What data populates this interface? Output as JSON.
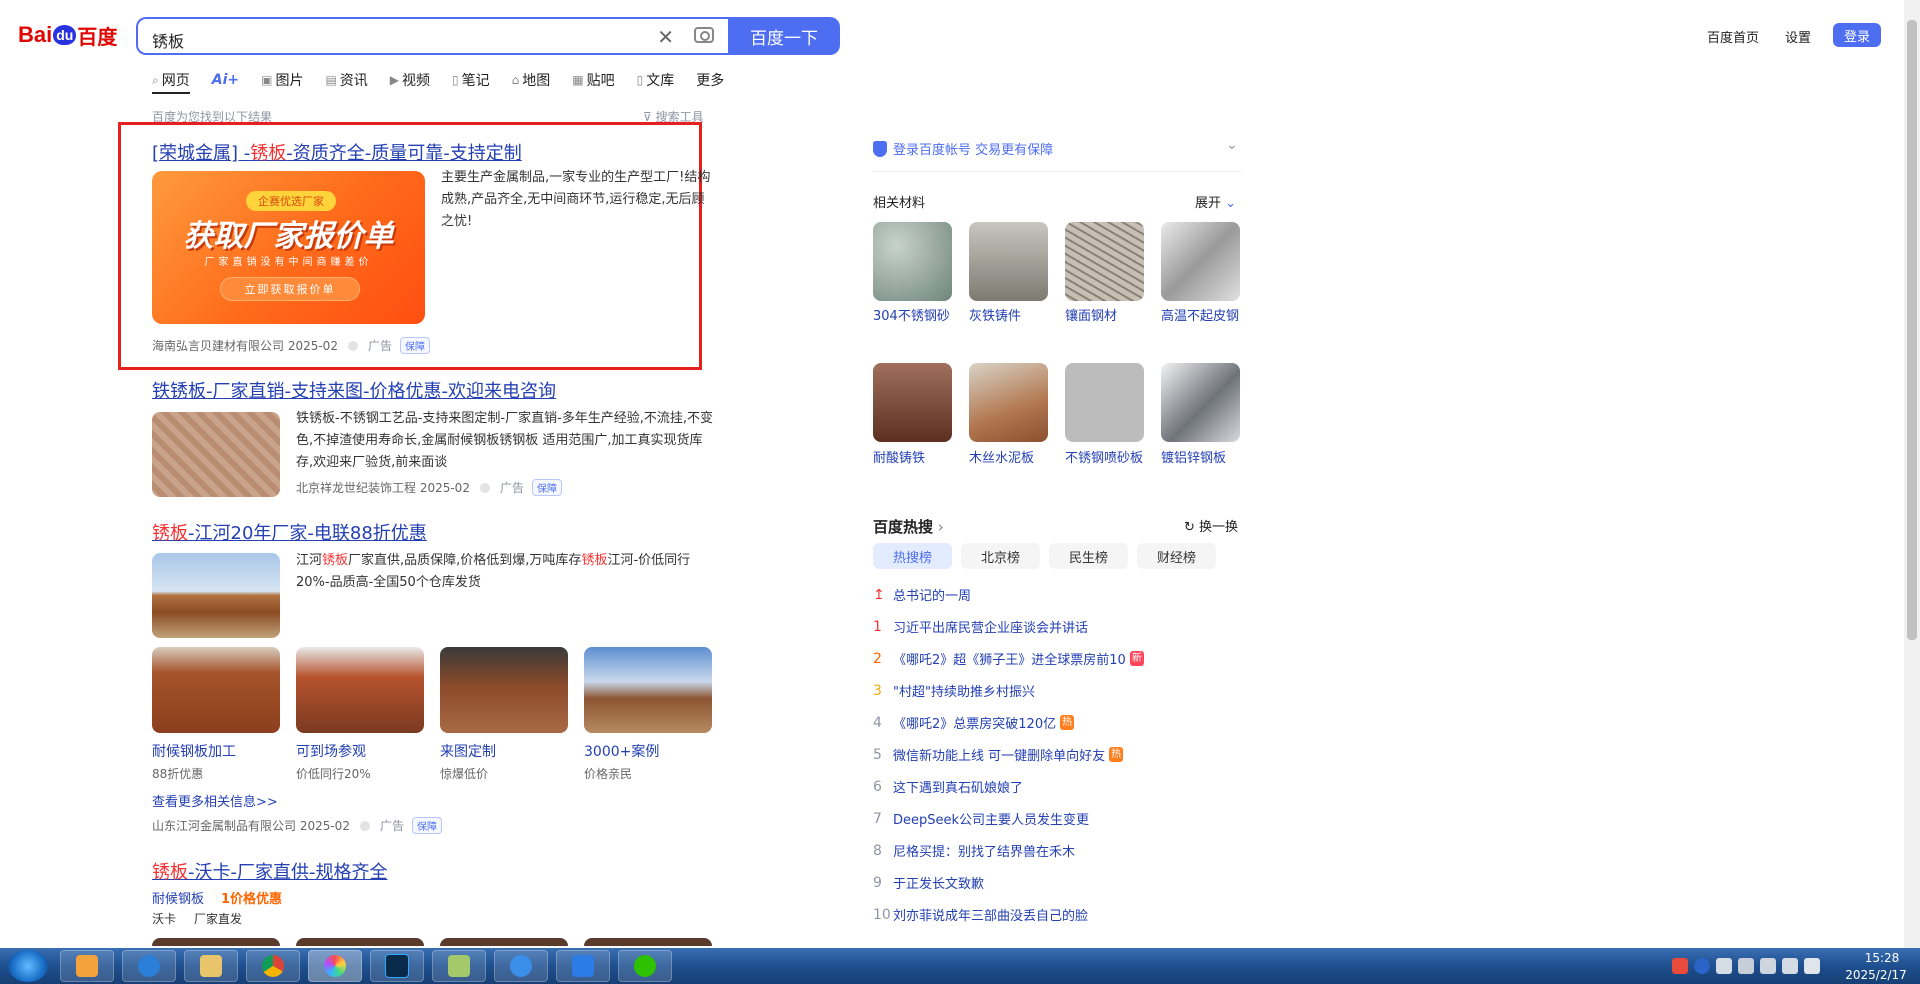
{
  "header": {
    "logo_bai": "Bai",
    "logo_du": "du",
    "logo_cn": "百度",
    "query": "锈板",
    "search_button": "百度一下",
    "links": [
      "百度首页",
      "设置"
    ],
    "login": "登录"
  },
  "tabs": [
    {
      "label": "网页",
      "icon": "search-icon"
    },
    {
      "label": "Ai+",
      "icon": ""
    },
    {
      "label": "图片",
      "icon": "image-icon"
    },
    {
      "label": "资讯",
      "icon": "news-icon"
    },
    {
      "label": "视频",
      "icon": "video-icon"
    },
    {
      "label": "笔记",
      "icon": "note-icon"
    },
    {
      "label": "地图",
      "icon": "map-icon"
    },
    {
      "label": "贴吧",
      "icon": "tieba-icon"
    },
    {
      "label": "文库",
      "icon": "doc-icon"
    },
    {
      "label": "更多",
      "icon": ""
    }
  ],
  "result_tip": "百度为您找到以下结果",
  "search_tools": "搜索工具",
  "results": {
    "r1": {
      "title_pre": "[荣城金属] -",
      "title_em": "锈板",
      "title_post": "-资质齐全-质量可靠-支持定制",
      "desc": "主要生产金属制品,一家专业的生产型工厂!结构成熟,产品齐全,无中间商环节,运行稳定,无后顾之忧!",
      "source": "海南弘言贝建材有限公司 2025-02",
      "ad": "广告",
      "guarantee": "保障",
      "banner": {
        "tag": "企赛优选厂家",
        "headline": "获取厂家报价单",
        "subline": "厂家直销没有中间商赚差价",
        "cta": "立即获取报价单"
      }
    },
    "r2": {
      "title": "铁锈板-厂家直销-支持来图-价格优惠-欢迎来电咨询",
      "desc": "铁锈板-不锈钢工艺品-支持来图定制-厂家直销-多年生产经验,不流挂,不变色,不掉渣使用寿命长,金属耐候钢板锈钢板 适用范围广,加工真实现货库存,欢迎来厂验货,前来面谈",
      "source": "北京祥龙世纪装饰工程 2025-02",
      "ad": "广告",
      "guarantee": "保障"
    },
    "r3": {
      "title_em": "锈板",
      "title_post": "-江河20年厂家-电联88折优惠",
      "desc_pre": "江河",
      "desc_em1": "锈板",
      "desc_mid": "厂家直供,品质保障,价格低到爆,万吨库存",
      "desc_em2": "锈板",
      "desc_post": "江河-价低同行20%-品质高-全国50个仓库发货",
      "grid": [
        {
          "caption": "耐候钢板加工",
          "sub": "88折优惠"
        },
        {
          "caption": "可到场参观",
          "sub": "价低同行20%"
        },
        {
          "caption": "来图定制",
          "sub": "惊爆低价"
        },
        {
          "caption": "3000+案例",
          "sub": "价格亲民"
        }
      ],
      "more": "查看更多相关信息>>",
      "source": "山东江河金属制品有限公司 2025-02",
      "ad": "广告",
      "guarantee": "保障"
    },
    "r4": {
      "title_em": "锈板",
      "title_post": "-沃卡-厂家直供-规格齐全",
      "sub_link": "耐候钢板",
      "sub_promo": "1价格优惠",
      "tag1": "沃卡",
      "tag2": "厂家直发"
    }
  },
  "sidebar": {
    "login_tip": "登录百度帐号 交易更有保障",
    "related_title": "相关材料",
    "expand": "展开",
    "related": [
      {
        "label": "304不锈钢砂",
        "color": "#8fa39b"
      },
      {
        "label": "灰铁铸件",
        "color": "#9a9890"
      },
      {
        "label": "镶面钢材",
        "color": "#a9a39a"
      },
      {
        "label": "高温不起皮钢",
        "color": "#b8b8b8"
      },
      {
        "label": "耐酸铸铁",
        "color": "#7a4a3a"
      },
      {
        "label": "木丝水泥板",
        "color": "#b07050"
      },
      {
        "label": "不锈钢喷砂板",
        "color": "#b5b5b5"
      },
      {
        "label": "镀铝锌钢板",
        "color": "#9aa0a8"
      }
    ],
    "hot_title": "百度热搜",
    "refresh": "换一换",
    "hot_tabs": [
      "热搜榜",
      "北京榜",
      "民生榜",
      "财经榜"
    ],
    "hot_list": [
      {
        "num": "",
        "text": "总书记的一周",
        "badge": ""
      },
      {
        "num": "1",
        "text": "习近平出席民营企业座谈会并讲话",
        "badge": ""
      },
      {
        "num": "2",
        "text": "《哪吒2》超《狮子王》进全球票房前10",
        "badge": "新"
      },
      {
        "num": "3",
        "text": "\"村超\"持续助推乡村振兴",
        "badge": ""
      },
      {
        "num": "4",
        "text": "《哪吒2》总票房突破120亿",
        "badge": "热"
      },
      {
        "num": "5",
        "text": "微信新功能上线 可一键删除单向好友",
        "badge": "热"
      },
      {
        "num": "6",
        "text": "这下遇到真石矶娘娘了",
        "badge": ""
      },
      {
        "num": "7",
        "text": "DeepSeek公司主要人员发生变更",
        "badge": ""
      },
      {
        "num": "8",
        "text": "尼格买提：别找了结界兽在禾木",
        "badge": ""
      },
      {
        "num": "9",
        "text": "于正发长文致歉",
        "badge": ""
      },
      {
        "num": "10",
        "text": "刘亦菲说成年三部曲没丢自己的脸",
        "badge": ""
      }
    ]
  },
  "taskbar": {
    "time": "15:28",
    "date": "2025/2/17"
  },
  "colors": {
    "accent": "#4e6ef2",
    "link": "#2440b3",
    "highlight": "#f73131",
    "box": "#e5201f"
  }
}
